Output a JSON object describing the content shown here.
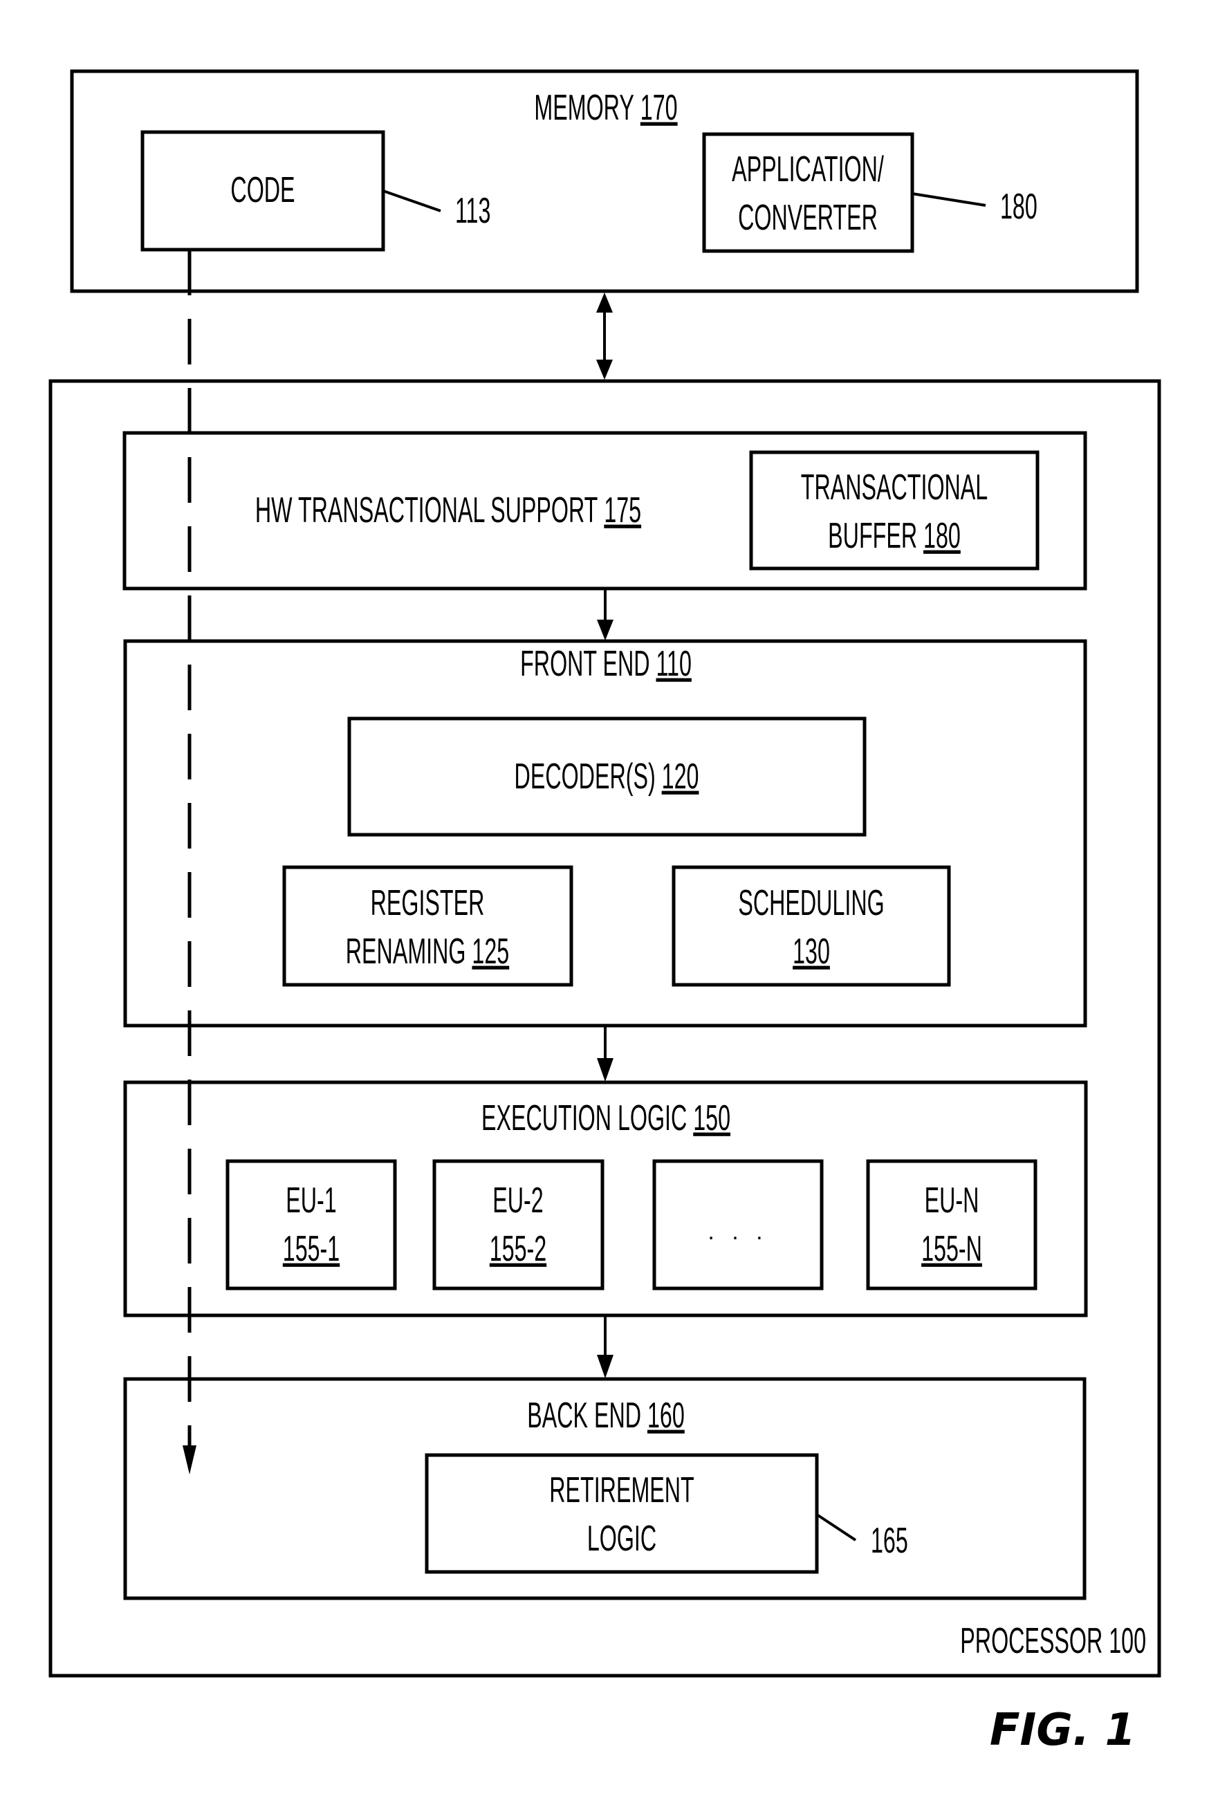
{
  "figure_label": "FIG. 1",
  "memory": {
    "title": "MEMORY",
    "ref": "170",
    "code": {
      "label": "CODE",
      "callout": "113"
    },
    "application": {
      "line1": "APPLICATION/",
      "line2": "CONVERTER",
      "callout": "180"
    }
  },
  "processor": {
    "title": "PROCESSOR",
    "ref": "100",
    "hw_support": {
      "title": "HW TRANSACTIONAL SUPPORT",
      "ref": "175",
      "buffer": {
        "line1": "TRANSACTIONAL",
        "line2": "BUFFER",
        "ref": "180"
      }
    },
    "front_end": {
      "title": "FRONT END",
      "ref": "110",
      "decoder": {
        "label": "DECODER(S)",
        "ref": "120"
      },
      "register_renaming": {
        "line1": "REGISTER",
        "line2": "RENAMING",
        "ref": "125"
      },
      "scheduling": {
        "line1": "SCHEDULING",
        "ref": "130"
      }
    },
    "execution_logic": {
      "title": "EXECUTION LOGIC",
      "ref": "150",
      "units": [
        {
          "name": "EU-1",
          "ref": "155-1"
        },
        {
          "name": "EU-2",
          "ref": "155-2"
        },
        {
          "name": "",
          "ref": "",
          "ellipsis": ". . ."
        },
        {
          "name": "EU-N",
          "ref": "155-N"
        }
      ]
    },
    "back_end": {
      "title": "BACK END",
      "ref": "160",
      "retirement": {
        "line1": "RETIREMENT",
        "line2": "LOGIC",
        "callout": "165"
      }
    }
  }
}
